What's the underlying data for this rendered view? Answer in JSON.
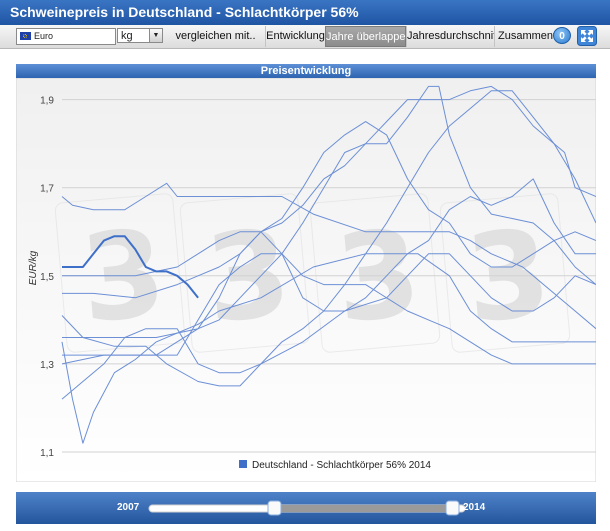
{
  "header": {
    "title": "Schweinepreis in Deutschland - Schlachtkörper 56%"
  },
  "toolbar": {
    "currency": "Euro",
    "unit": "kg",
    "compare_label": "vergleichen mit..",
    "tabs": [
      {
        "label": "Entwicklung",
        "active": false
      },
      {
        "label": "Jahre überlappen",
        "active": true
      },
      {
        "label": "Jahresdurchschnitt",
        "active": false
      },
      {
        "label": "Zusammenfass",
        "active": false
      }
    ],
    "badge_count": "0"
  },
  "chart_panel": {
    "title": "Preisentwicklung"
  },
  "range_slider": {
    "start_year": "2007",
    "end_year": "2014"
  },
  "colors": {
    "accent": "#2457a6",
    "series_line": "#6c8fd6",
    "highlight": "#3e6fc9"
  },
  "chart_data": {
    "type": "line",
    "title": "Preisentwicklung",
    "xlabel": "",
    "ylabel": "EUR/kg",
    "ylim": [
      1.1,
      1.94
    ],
    "yticks": [
      1.1,
      1.3,
      1.5,
      1.7,
      1.9
    ],
    "ytick_labels": [
      "1,1",
      "1,3",
      "1,5",
      "1,7",
      "1,9"
    ],
    "x_range": [
      1,
      52
    ],
    "grid": true,
    "legend_position": "bottom",
    "legend": [
      "Deutschland - Schlachtkörper 56% 2014"
    ],
    "series": [
      {
        "name": "Deutschland - Schlachtkörper 56% 2014",
        "highlight": true,
        "points": [
          [
            1,
            1.52
          ],
          [
            2,
            1.52
          ],
          [
            3,
            1.52
          ],
          [
            4,
            1.55
          ],
          [
            5,
            1.58
          ],
          [
            6,
            1.59
          ],
          [
            7,
            1.59
          ],
          [
            8,
            1.56
          ],
          [
            9,
            1.52
          ],
          [
            10,
            1.51
          ],
          [
            11,
            1.51
          ],
          [
            12,
            1.5
          ],
          [
            13,
            1.48
          ],
          [
            14,
            1.45
          ]
        ]
      },
      {
        "points": [
          [
            1,
            1.68
          ],
          [
            2,
            1.66
          ],
          [
            4,
            1.65
          ],
          [
            7,
            1.65
          ],
          [
            9,
            1.68
          ],
          [
            11,
            1.71
          ],
          [
            12,
            1.68
          ],
          [
            16,
            1.68
          ],
          [
            20,
            1.68
          ],
          [
            22,
            1.68
          ],
          [
            25,
            1.64
          ],
          [
            30,
            1.6
          ],
          [
            35,
            1.6
          ],
          [
            38,
            1.6
          ],
          [
            40,
            1.58
          ],
          [
            42,
            1.55
          ],
          [
            45,
            1.52
          ],
          [
            50,
            1.42
          ],
          [
            52,
            1.38
          ]
        ]
      },
      {
        "points": [
          [
            1,
            1.35
          ],
          [
            2,
            1.22
          ],
          [
            3,
            1.12
          ],
          [
            4,
            1.19
          ],
          [
            6,
            1.28
          ],
          [
            8,
            1.31
          ],
          [
            10,
            1.35
          ],
          [
            12,
            1.37
          ],
          [
            13,
            1.38
          ],
          [
            14,
            1.39
          ],
          [
            16,
            1.42
          ],
          [
            20,
            1.45
          ],
          [
            25,
            1.52
          ],
          [
            30,
            1.55
          ],
          [
            35,
            1.55
          ],
          [
            38,
            1.5
          ],
          [
            40,
            1.42
          ],
          [
            42,
            1.38
          ],
          [
            44,
            1.35
          ],
          [
            46,
            1.35
          ],
          [
            48,
            1.35
          ],
          [
            50,
            1.35
          ],
          [
            52,
            1.35
          ]
        ]
      },
      {
        "points": [
          [
            1,
            1.22
          ],
          [
            3,
            1.26
          ],
          [
            5,
            1.3
          ],
          [
            7,
            1.36
          ],
          [
            9,
            1.38
          ],
          [
            12,
            1.38
          ],
          [
            14,
            1.3
          ],
          [
            16,
            1.28
          ],
          [
            18,
            1.28
          ],
          [
            20,
            1.3
          ],
          [
            24,
            1.35
          ],
          [
            28,
            1.42
          ],
          [
            32,
            1.45
          ],
          [
            36,
            1.55
          ],
          [
            38,
            1.55
          ],
          [
            40,
            1.5
          ],
          [
            42,
            1.45
          ],
          [
            44,
            1.42
          ],
          [
            46,
            1.42
          ],
          [
            48,
            1.45
          ],
          [
            50,
            1.5
          ],
          [
            52,
            1.48
          ]
        ]
      },
      {
        "points": [
          [
            1,
            1.41
          ],
          [
            3,
            1.36
          ],
          [
            6,
            1.34
          ],
          [
            9,
            1.34
          ],
          [
            11,
            1.3
          ],
          [
            14,
            1.26
          ],
          [
            16,
            1.25
          ],
          [
            18,
            1.25
          ],
          [
            20,
            1.3
          ],
          [
            22,
            1.35
          ],
          [
            24,
            1.38
          ],
          [
            26,
            1.42
          ],
          [
            28,
            1.48
          ],
          [
            30,
            1.55
          ],
          [
            32,
            1.62
          ],
          [
            34,
            1.7
          ],
          [
            36,
            1.78
          ],
          [
            38,
            1.84
          ],
          [
            40,
            1.88
          ],
          [
            42,
            1.92
          ],
          [
            44,
            1.92
          ],
          [
            46,
            1.86
          ],
          [
            48,
            1.8
          ],
          [
            50,
            1.72
          ],
          [
            52,
            1.62
          ]
        ]
      },
      {
        "points": [
          [
            1,
            1.36
          ],
          [
            5,
            1.36
          ],
          [
            10,
            1.36
          ],
          [
            14,
            1.38
          ],
          [
            16,
            1.4
          ],
          [
            18,
            1.45
          ],
          [
            20,
            1.5
          ],
          [
            22,
            1.55
          ],
          [
            24,
            1.62
          ],
          [
            26,
            1.7
          ],
          [
            28,
            1.78
          ],
          [
            30,
            1.8
          ],
          [
            32,
            1.8
          ],
          [
            34,
            1.86
          ],
          [
            36,
            1.93
          ],
          [
            37,
            1.93
          ],
          [
            38,
            1.82
          ],
          [
            40,
            1.7
          ],
          [
            42,
            1.64
          ],
          [
            44,
            1.63
          ],
          [
            46,
            1.62
          ],
          [
            48,
            1.58
          ],
          [
            50,
            1.52
          ],
          [
            52,
            1.48
          ]
        ]
      },
      {
        "points": [
          [
            1,
            1.3
          ],
          [
            5,
            1.32
          ],
          [
            10,
            1.32
          ],
          [
            14,
            1.38
          ],
          [
            16,
            1.45
          ],
          [
            18,
            1.55
          ],
          [
            20,
            1.6
          ],
          [
            22,
            1.62
          ],
          [
            24,
            1.66
          ],
          [
            26,
            1.72
          ],
          [
            28,
            1.75
          ],
          [
            30,
            1.8
          ],
          [
            32,
            1.85
          ],
          [
            34,
            1.9
          ],
          [
            36,
            1.9
          ],
          [
            38,
            1.9
          ],
          [
            40,
            1.92
          ],
          [
            42,
            1.93
          ],
          [
            44,
            1.9
          ],
          [
            46,
            1.84
          ],
          [
            48,
            1.8
          ],
          [
            49,
            1.78
          ],
          [
            50,
            1.7
          ],
          [
            52,
            1.68
          ]
        ]
      },
      {
        "points": [
          [
            1,
            1.32
          ],
          [
            4,
            1.32
          ],
          [
            8,
            1.32
          ],
          [
            12,
            1.32
          ],
          [
            14,
            1.4
          ],
          [
            16,
            1.48
          ],
          [
            18,
            1.52
          ],
          [
            20,
            1.55
          ],
          [
            22,
            1.55
          ],
          [
            24,
            1.5
          ],
          [
            26,
            1.48
          ],
          [
            28,
            1.48
          ],
          [
            30,
            1.48
          ],
          [
            32,
            1.45
          ],
          [
            34,
            1.42
          ],
          [
            36,
            1.4
          ],
          [
            38,
            1.38
          ],
          [
            40,
            1.35
          ],
          [
            42,
            1.32
          ],
          [
            44,
            1.3
          ],
          [
            46,
            1.3
          ],
          [
            48,
            1.3
          ],
          [
            50,
            1.3
          ],
          [
            52,
            1.3
          ]
        ]
      },
      {
        "points": [
          [
            1,
            1.46
          ],
          [
            4,
            1.46
          ],
          [
            8,
            1.45
          ],
          [
            12,
            1.48
          ],
          [
            14,
            1.5
          ],
          [
            16,
            1.52
          ],
          [
            18,
            1.55
          ],
          [
            20,
            1.6
          ],
          [
            22,
            1.63
          ],
          [
            24,
            1.7
          ],
          [
            26,
            1.78
          ],
          [
            28,
            1.82
          ],
          [
            30,
            1.85
          ],
          [
            32,
            1.82
          ],
          [
            34,
            1.72
          ],
          [
            36,
            1.65
          ],
          [
            38,
            1.62
          ],
          [
            40,
            1.55
          ],
          [
            42,
            1.52
          ],
          [
            44,
            1.52
          ],
          [
            46,
            1.55
          ],
          [
            48,
            1.58
          ],
          [
            50,
            1.6
          ],
          [
            52,
            1.58
          ]
        ]
      },
      {
        "points": [
          [
            1,
            1.5
          ],
          [
            4,
            1.5
          ],
          [
            8,
            1.5
          ],
          [
            12,
            1.52
          ],
          [
            14,
            1.55
          ],
          [
            16,
            1.58
          ],
          [
            18,
            1.6
          ],
          [
            20,
            1.6
          ],
          [
            22,
            1.55
          ],
          [
            24,
            1.45
          ],
          [
            26,
            1.42
          ],
          [
            28,
            1.42
          ],
          [
            30,
            1.45
          ],
          [
            32,
            1.5
          ],
          [
            34,
            1.55
          ],
          [
            36,
            1.58
          ],
          [
            38,
            1.65
          ],
          [
            40,
            1.68
          ],
          [
            42,
            1.66
          ],
          [
            44,
            1.68
          ],
          [
            46,
            1.72
          ],
          [
            48,
            1.62
          ],
          [
            50,
            1.55
          ],
          [
            52,
            1.55
          ]
        ]
      }
    ]
  }
}
